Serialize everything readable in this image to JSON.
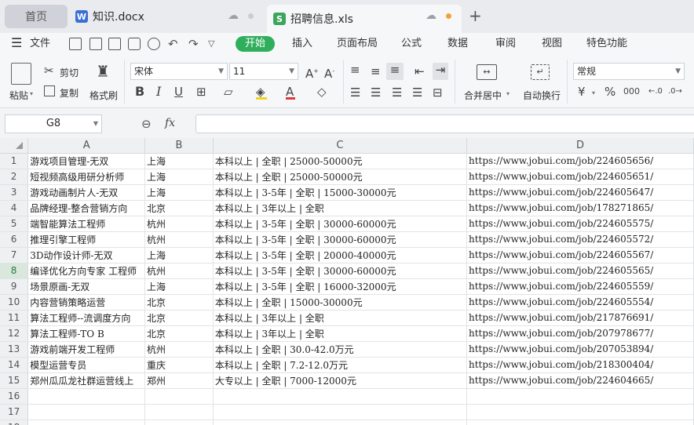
{
  "tabs": {
    "home": "首页",
    "doc": "知识.docx",
    "xls": "招聘信息.xls",
    "new_tab": "+"
  },
  "menu": {
    "file": "文件",
    "items": [
      "开始",
      "插入",
      "页面布局",
      "公式",
      "数据",
      "审阅",
      "视图",
      "特色功能"
    ]
  },
  "ribbon": {
    "paste": "粘贴",
    "cut": "剪切",
    "copy": "复制",
    "format_painter": "格式刷",
    "font_name": "宋体",
    "font_size": "11",
    "bold": "B",
    "italic": "I",
    "underline": "U",
    "merge_center": "合并居中",
    "wrap_text": "自动换行",
    "number_format": "常规",
    "currency": "¥",
    "percent": "%",
    "thousands": "000"
  },
  "formula_bar": {
    "cell_ref": "G8",
    "fx": "fx",
    "value": ""
  },
  "sheet": {
    "columns": [
      "A",
      "B",
      "C",
      "D"
    ],
    "selected_row": 8,
    "rows": [
      [
        "游戏项目管理-无双",
        "上海",
        "本科以上 | 全职 | 25000-50000元",
        "https://www.jobui.com/job/224605656/"
      ],
      [
        "短视频高级用研分析师",
        "上海",
        "本科以上 | 全职 | 25000-50000元",
        "https://www.jobui.com/job/224605651/"
      ],
      [
        "游戏动画制片人-无双",
        "上海",
        "本科以上 | 3-5年 | 全职 | 15000-30000元",
        "https://www.jobui.com/job/224605647/"
      ],
      [
        "品牌经理-整合营销方向",
        "北京",
        "本科以上 | 3年以上 | 全职",
        "https://www.jobui.com/job/178271865/"
      ],
      [
        "端智能算法工程师",
        "杭州",
        "本科以上 | 3-5年 | 全职 | 30000-60000元",
        "https://www.jobui.com/job/224605575/"
      ],
      [
        "推理引擎工程师",
        "杭州",
        "本科以上 | 3-5年 | 全职 | 30000-60000元",
        "https://www.jobui.com/job/224605572/"
      ],
      [
        "3D动作设计师-无双",
        "上海",
        "本科以上 | 3-5年 | 全职 | 20000-40000元",
        "https://www.jobui.com/job/224605567/"
      ],
      [
        "编译优化方向专家 工程师",
        "杭州",
        "本科以上 | 3-5年 | 全职 | 30000-60000元",
        "https://www.jobui.com/job/224605565/"
      ],
      [
        "场景原画-无双",
        "上海",
        "本科以上 | 3-5年 | 全职 | 16000-32000元",
        "https://www.jobui.com/job/224605559/"
      ],
      [
        "内容营销策略运营",
        "北京",
        "本科以上 | 全职 | 15000-30000元",
        "https://www.jobui.com/job/224605554/"
      ],
      [
        "算法工程师--流调度方向",
        "北京",
        "本科以上 | 3年以上 | 全职",
        "https://www.jobui.com/job/217876691/"
      ],
      [
        "算法工程师-TO B",
        "北京",
        "本科以上 | 3年以上 | 全职",
        "https://www.jobui.com/job/207978677/"
      ],
      [
        "游戏前端开发工程师",
        "杭州",
        "本科以上 | 全职 | 30.0-42.0万元",
        "https://www.jobui.com/job/207053894/"
      ],
      [
        "模型运营专员",
        "重庆",
        "本科以上 | 全职 | 7.2-12.0万元",
        "https://www.jobui.com/job/218300404/"
      ],
      [
        "郑州瓜瓜龙社群运营线上",
        "郑州",
        "大专以上 | 全职 | 7000-12000元",
        "https://www.jobui.com/job/224604665/"
      ],
      [
        "",
        "",
        "",
        ""
      ],
      [
        "",
        "",
        "",
        ""
      ],
      [
        "",
        "",
        "",
        ""
      ]
    ]
  },
  "colors": {
    "accent": "#2fae5c",
    "doc_icon": "#3c6fd6",
    "xls_icon": "#3ea55f",
    "unsaved_dot": "#f0a23a"
  }
}
